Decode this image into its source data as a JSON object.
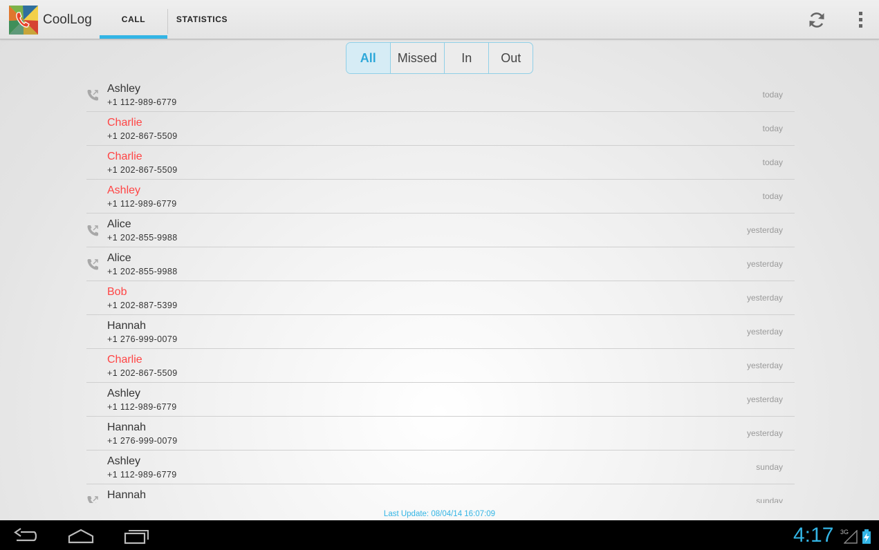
{
  "app": {
    "title": "CoolLog"
  },
  "tabs": [
    {
      "label": "CALL",
      "selected": true
    },
    {
      "label": "STATISTICS",
      "selected": false
    }
  ],
  "filter": {
    "options": [
      "All",
      "Missed",
      "In",
      "Out"
    ],
    "selected": "All"
  },
  "calls": [
    {
      "name": "Ashley",
      "number": "+1 112-989-6779",
      "when": "today",
      "type": "outgoing"
    },
    {
      "name": "Charlie",
      "number": "+1 202-867-5509",
      "when": "today",
      "type": "missed"
    },
    {
      "name": "Charlie",
      "number": "+1 202-867-5509",
      "when": "today",
      "type": "missed"
    },
    {
      "name": "Ashley",
      "number": "+1 112-989-6779",
      "when": "today",
      "type": "missed"
    },
    {
      "name": "Alice",
      "number": "+1 202-855-9988",
      "when": "yesterday",
      "type": "outgoing"
    },
    {
      "name": "Alice",
      "number": "+1 202-855-9988",
      "when": "yesterday",
      "type": "outgoing"
    },
    {
      "name": "Bob",
      "number": "+1 202-887-5399",
      "when": "yesterday",
      "type": "missed"
    },
    {
      "name": "Hannah",
      "number": "+1 276-999-0079",
      "when": "yesterday",
      "type": "incoming"
    },
    {
      "name": "Charlie",
      "number": "+1 202-867-5509",
      "when": "yesterday",
      "type": "missed"
    },
    {
      "name": "Ashley",
      "number": "+1 112-989-6779",
      "when": "yesterday",
      "type": "incoming"
    },
    {
      "name": "Hannah",
      "number": "+1 276-999-0079",
      "when": "yesterday",
      "type": "incoming"
    },
    {
      "name": "Ashley",
      "number": "+1 112-989-6779",
      "when": "sunday",
      "type": "incoming"
    },
    {
      "name": "Hannah",
      "number": "",
      "when": "sunday",
      "type": "outgoing"
    }
  ],
  "last_update": "Last Update: 08/04/14 16:07:09",
  "system": {
    "clock": "4:17",
    "network": "3G"
  },
  "colors": {
    "accent": "#33b5e5",
    "missed": "#ff4444"
  }
}
